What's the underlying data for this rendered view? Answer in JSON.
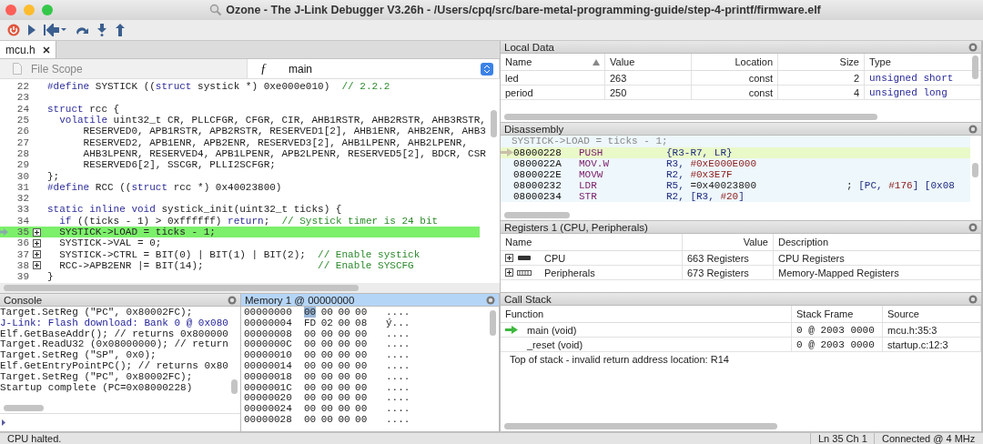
{
  "window": {
    "title": "Ozone - The J-Link Debugger V3.26h - /Users/cpq/src/bare-metal-programming-guide/step-4-printf/firmware.elf"
  },
  "editor": {
    "tabs": [
      {
        "label": "mcu.h",
        "selected": true
      }
    ],
    "scope": "File Scope",
    "function_glyph": "ƒ",
    "function": "main",
    "lines": [
      {
        "number": "22",
        "current": false,
        "expandable": false,
        "segments": [
          {
            "kind": "keyword",
            "t": "#define"
          },
          {
            "t": " SYSTICK (("
          },
          {
            "kind": "keyword",
            "t": "struct"
          },
          {
            "t": " systick *) 0xe000e010)  "
          },
          {
            "kind": "comment",
            "t": "// 2.2.2"
          }
        ]
      },
      {
        "number": "23",
        "current": false,
        "expandable": false
      },
      {
        "number": "24",
        "current": false,
        "expandable": false,
        "segments": [
          {
            "kind": "keyword",
            "t": "struct"
          },
          {
            "t": " rcc {"
          }
        ]
      },
      {
        "number": "25",
        "current": false,
        "expandable": false,
        "segments": [
          {
            "kind": "keyword",
            "t": "  volatile"
          },
          {
            "t": " uint32_t CR, PLLCFGR, CFGR, CIR, AHB1RSTR, AHB2RSTR, AHB3RSTR,"
          }
        ]
      },
      {
        "number": "26",
        "current": false,
        "expandable": false,
        "segments": [
          {
            "t": "      RESERVED0, APB1RSTR, APB2RSTR, RESERVED1[2], AHB1ENR, AHB2ENR, AHB3"
          }
        ]
      },
      {
        "number": "27",
        "current": false,
        "expandable": false,
        "segments": [
          {
            "t": "      RESERVED2, APB1ENR, APB2ENR, RESERVED3[2], AHB1LPENR, AHB2LPENR,"
          }
        ]
      },
      {
        "number": "28",
        "current": false,
        "expandable": false,
        "segments": [
          {
            "t": "      AHB3LPENR, RESERVED4, APB1LPENR, APB2LPENR, RESERVED5[2], BDCR, CSR"
          }
        ]
      },
      {
        "number": "29",
        "current": false,
        "expandable": false,
        "segments": [
          {
            "t": "      RESERVED6[2], SSCGR, PLLI2SCFGR;"
          }
        ]
      },
      {
        "number": "30",
        "current": false,
        "expandable": false,
        "segments": [
          {
            "t": "};"
          }
        ]
      },
      {
        "number": "31",
        "current": false,
        "expandable": false,
        "segments": [
          {
            "kind": "keyword",
            "t": "#define"
          },
          {
            "t": " RCC (("
          },
          {
            "kind": "keyword",
            "t": "struct"
          },
          {
            "t": " rcc *) 0x40023800)"
          }
        ]
      },
      {
        "number": "32",
        "current": false,
        "expandable": false
      },
      {
        "number": "33",
        "current": false,
        "expandable": false,
        "segments": [
          {
            "kind": "keyword",
            "t": "static inline void"
          },
          {
            "t": " systick_init(uint32_t ticks) {"
          }
        ]
      },
      {
        "number": "34",
        "current": false,
        "expandable": false,
        "segments": [
          {
            "kind": "keyword",
            "t": "  if"
          },
          {
            "t": " ((ticks - 1) > 0xffffff) "
          },
          {
            "kind": "keyword",
            "t": "return"
          },
          {
            "t": ";  "
          },
          {
            "kind": "comment",
            "t": "// Systick timer is 24 bit"
          }
        ]
      },
      {
        "number": "35",
        "current": true,
        "expandable": true,
        "segments": [
          {
            "t": "  SYSTICK->LOAD = ticks - 1;"
          }
        ]
      },
      {
        "number": "36",
        "current": false,
        "expandable": true,
        "segments": [
          {
            "t": "  SYSTICK->VAL = 0;"
          }
        ]
      },
      {
        "number": "37",
        "current": false,
        "expandable": true,
        "segments": [
          {
            "t": "  SYSTICK->CTRL = BIT(0) | BIT(1) | BIT(2);  "
          },
          {
            "kind": "comment",
            "t": "// Enable systick"
          }
        ]
      },
      {
        "number": "38",
        "current": false,
        "expandable": true,
        "segments": [
          {
            "t": "  RCC->APB2ENR |= BIT(14);                   "
          },
          {
            "kind": "comment",
            "t": "// Enable SYSCFG"
          }
        ]
      },
      {
        "number": "39",
        "current": false,
        "expandable": false,
        "segments": [
          {
            "t": "}"
          }
        ]
      }
    ]
  },
  "console": {
    "title": "Console",
    "lines": [
      {
        "kind": "command",
        "text": "Target.SetReg (\"PC\", 0x80002FC);"
      },
      {
        "kind": "info",
        "text": "J-Link: Flash download: Bank 0 @ 0x080"
      },
      {
        "kind": "command",
        "text": "Elf.GetBaseAddr(); // returns 0x800000"
      },
      {
        "kind": "command",
        "text": "Target.ReadU32 (0x08000000); // return"
      },
      {
        "kind": "command",
        "text": "Target.SetReg (\"SP\", 0x0);"
      },
      {
        "kind": "command",
        "text": "Elf.GetEntryPointPC(); // returns 0x80"
      },
      {
        "kind": "command",
        "text": "Target.SetReg (\"PC\", 0x80002FC);"
      },
      {
        "kind": "command",
        "text": "Startup complete (PC=0x08000228)"
      }
    ]
  },
  "memory": {
    "title": "Memory 1 @ 00000000",
    "rows": [
      {
        "address": "00000000",
        "bytes": [
          "00",
          "00",
          "00",
          "00"
        ],
        "ascii": "....",
        "cursor": true
      },
      {
        "address": "00000004",
        "bytes": [
          "FD",
          "02",
          "00",
          "08"
        ],
        "ascii": "ý...",
        "cursor": false
      },
      {
        "address": "00000008",
        "bytes": [
          "00",
          "00",
          "00",
          "00"
        ],
        "ascii": "....",
        "cursor": false
      },
      {
        "address": "0000000C",
        "bytes": [
          "00",
          "00",
          "00",
          "00"
        ],
        "ascii": "....",
        "cursor": false
      },
      {
        "address": "00000010",
        "bytes": [
          "00",
          "00",
          "00",
          "00"
        ],
        "ascii": "....",
        "cursor": false
      },
      {
        "address": "00000014",
        "bytes": [
          "00",
          "00",
          "00",
          "00"
        ],
        "ascii": "....",
        "cursor": false
      },
      {
        "address": "00000018",
        "bytes": [
          "00",
          "00",
          "00",
          "00"
        ],
        "ascii": "....",
        "cursor": false
      },
      {
        "address": "0000001C",
        "bytes": [
          "00",
          "00",
          "00",
          "00"
        ],
        "ascii": "....",
        "cursor": false
      },
      {
        "address": "00000020",
        "bytes": [
          "00",
          "00",
          "00",
          "00"
        ],
        "ascii": "....",
        "cursor": false
      },
      {
        "address": "00000024",
        "bytes": [
          "00",
          "00",
          "00",
          "00"
        ],
        "ascii": "....",
        "cursor": false
      },
      {
        "address": "00000028",
        "bytes": [
          "00",
          "00",
          "00",
          "00"
        ],
        "ascii": "....",
        "cursor": false
      }
    ]
  },
  "local_data": {
    "title": "Local Data",
    "columns": [
      "Name",
      "Value",
      "Location",
      "Size",
      "Type"
    ],
    "rows": [
      {
        "name": "led",
        "value": "263",
        "location": "const",
        "size": "2",
        "type": "unsigned short"
      },
      {
        "name": "period",
        "value": "250",
        "location": "const",
        "size": "4",
        "type": "unsigned long"
      }
    ]
  },
  "disassembly": {
    "title": "Disassembly",
    "source": "SYSTICK->LOAD = ticks - 1;",
    "rows": [
      {
        "address": "08000228",
        "mnemonic": "PUSH",
        "current": true,
        "operands": [
          {
            "kind": "register",
            "t": "{R3-R7, LR}"
          }
        ]
      },
      {
        "address": "0800022A",
        "mnemonic": "MOV.W",
        "current": false,
        "operands": [
          {
            "kind": "register",
            "t": "R3, "
          },
          {
            "kind": "immediate",
            "t": "#0xE000E000"
          }
        ]
      },
      {
        "address": "0800022E",
        "mnemonic": "MOVW",
        "current": false,
        "operands": [
          {
            "kind": "register",
            "t": "R2, "
          },
          {
            "kind": "immediate",
            "t": "#0x3E7F"
          }
        ]
      },
      {
        "address": "08000232",
        "mnemonic": "LDR",
        "current": false,
        "operands": [
          {
            "kind": "register",
            "t": "R5, "
          },
          {
            "t": "=0x40023800"
          }
        ],
        "comment": [
          {
            "t": "; "
          },
          {
            "kind": "register",
            "t": "[PC, "
          },
          {
            "kind": "immediate",
            "t": "#176"
          },
          {
            "kind": "register",
            "t": "] [0x08"
          }
        ]
      },
      {
        "address": "08000234",
        "mnemonic": "STR",
        "current": false,
        "operands": [
          {
            "kind": "register",
            "t": "R2, [R3, "
          },
          {
            "kind": "immediate",
            "t": "#20"
          },
          {
            "kind": "register",
            "t": "]"
          }
        ]
      }
    ]
  },
  "registers": {
    "title": "Registers 1 (CPU, Peripherals)",
    "columns": [
      "Name",
      "Value",
      "Description"
    ],
    "rows": [
      {
        "kind": "cpu",
        "name": "CPU",
        "value": "663 Registers",
        "description": "CPU Registers",
        "expanded": false
      },
      {
        "kind": "peripherals",
        "name": "Peripherals",
        "value": "673 Registers",
        "description": "Memory-Mapped Registers",
        "expanded": false
      }
    ]
  },
  "call_stack": {
    "title": "Call Stack",
    "columns": [
      "Function",
      "Stack Frame",
      "Source"
    ],
    "rows": [
      {
        "function": "main (void)",
        "frame": "0 @ 2003 0000",
        "source": "mcu.h:35:3",
        "current": true
      },
      {
        "function": "_reset (void)",
        "frame": "0 @ 2003 0000",
        "source": "startup.c:12:3",
        "current": false
      }
    ],
    "message": "Top of stack - invalid return address location: R14"
  },
  "status_bar": {
    "state": "CPU halted.",
    "position": "Ln 35  Ch 1",
    "connection": "Connected @ 4 MHz"
  }
}
